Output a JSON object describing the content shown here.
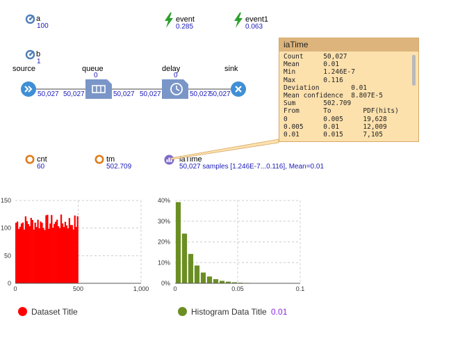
{
  "params": [
    {
      "name": "a",
      "value": "100"
    },
    {
      "name": "b",
      "value": "1"
    }
  ],
  "events": [
    {
      "name": "event",
      "value": "0.285"
    },
    {
      "name": "event1",
      "value": "0.063"
    }
  ],
  "blocks": {
    "source": {
      "label": "source",
      "out": "50,027"
    },
    "queue": {
      "label": "queue",
      "count": "0",
      "in": "50,027",
      "out": "50,027"
    },
    "delay": {
      "label": "delay",
      "count": "0",
      "in": "50,027",
      "out": "50,027"
    },
    "sink": {
      "label": "sink",
      "in": "50,027"
    }
  },
  "stats": [
    {
      "name": "cnt",
      "value": "60"
    },
    {
      "name": "tm",
      "value": "502.709"
    }
  ],
  "dataset": {
    "name": "iaTime",
    "summary": "50,027 samples [1.246E-7...0.116], Mean=0.01"
  },
  "tooltip": {
    "title": "iaTime",
    "text": "Count     50,027\nMean      0.01\nMin       1.246E-7\nMax       0.116\nDeviation        0.01\nMean confidence  8.807E-5\nSum       502.709\nFrom      To        PDF(hits)      C\n0         0.005     19,628         3\n0.005     0.01      12,009         6\n0.01      0.015     7,105          8"
  },
  "colors": {
    "dataset": "#ff0000",
    "histogram": "#6b8e23",
    "value_text": "#1a1ab8",
    "tooltip_bg": "#fde1ad",
    "block": "#7a96c8",
    "source_sink": "#3f8fd6",
    "event_icon": "#2aa12a",
    "stat_icon": "#e07b1a"
  },
  "chart_data": [
    {
      "type": "bar",
      "title": "",
      "series": [
        {
          "name": "Dataset Title",
          "x_range": [
            0,
            500
          ],
          "value_range": [
            95,
            125
          ],
          "mean": 110
        }
      ],
      "xlim": [
        0,
        1000
      ],
      "ylim": [
        0,
        150
      ],
      "xticks": [
        "0",
        "500",
        "1,000"
      ],
      "yticks": [
        "0",
        "50",
        "100",
        "150"
      ],
      "grid": true,
      "legend": "bottom"
    },
    {
      "type": "bar",
      "title": "",
      "bin_width": 0.005,
      "bins_start": [
        0,
        0.005,
        0.01,
        0.015,
        0.02,
        0.025,
        0.03,
        0.035,
        0.04,
        0.045,
        0.05,
        0.055
      ],
      "values": [
        39.2,
        24.0,
        14.2,
        8.6,
        5.2,
        3.3,
        2.0,
        1.2,
        0.8,
        0.5,
        0.3,
        0.2
      ],
      "series_name": "Histogram Data Title",
      "mean_label": "0.01",
      "xlim": [
        0,
        0.1
      ],
      "ylim": [
        0,
        40
      ],
      "xticks": [
        "0",
        "0.05",
        "0.1"
      ],
      "yticks": [
        "0%",
        "10%",
        "20%",
        "30%",
        "40%"
      ],
      "grid": true,
      "legend": "bottom"
    }
  ],
  "legends": [
    {
      "label": "Dataset Title",
      "extra": ""
    },
    {
      "label": "Histogram Data Title",
      "extra": "0.01"
    }
  ]
}
